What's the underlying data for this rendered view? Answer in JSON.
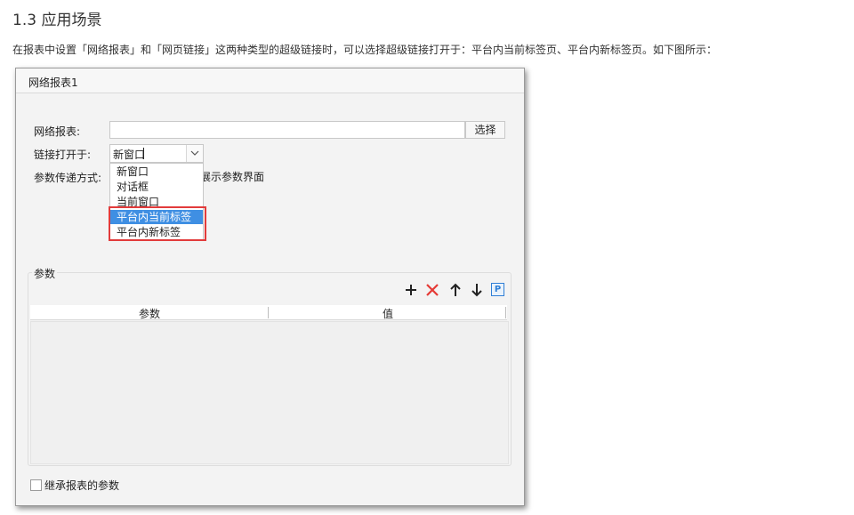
{
  "doc": {
    "heading": "1.3 应用场景",
    "intro": "在报表中设置「网络报表」和「网页链接」这两种类型的超级链接时，可以选择超级链接打开于：平台内当前标签页、平台内新标签页。如下图所示："
  },
  "dialog": {
    "tab_title": "网络报表1",
    "report_label": "网络报表:",
    "report_value": "",
    "choose_button": "选择",
    "open_in_label": "链接打开于:",
    "open_in_value": "新窗口",
    "param_mode_label": "参数传递方式:",
    "param_mode_partial": "展示参数界面",
    "dropdown_options": [
      "新窗口",
      "对话框",
      "当前窗口",
      "平台内当前标签",
      "平台内新标签"
    ],
    "selected_option": "平台内当前标签",
    "params_group_title": "参数",
    "table_columns": [
      "参数",
      "值"
    ],
    "toolbar_icons": [
      "plus-icon",
      "delete-icon",
      "arrow-up-icon",
      "arrow-down-icon",
      "parameter-p-icon"
    ],
    "p_icon_text": "P",
    "inherit_label": "继承报表的参数",
    "inherit_checked": false
  },
  "colors": {
    "highlight_red": "#e23b3b",
    "selection_blue": "#3f8fe3",
    "delete_red": "#e53935",
    "p_icon_blue": "#2f7fd6"
  }
}
